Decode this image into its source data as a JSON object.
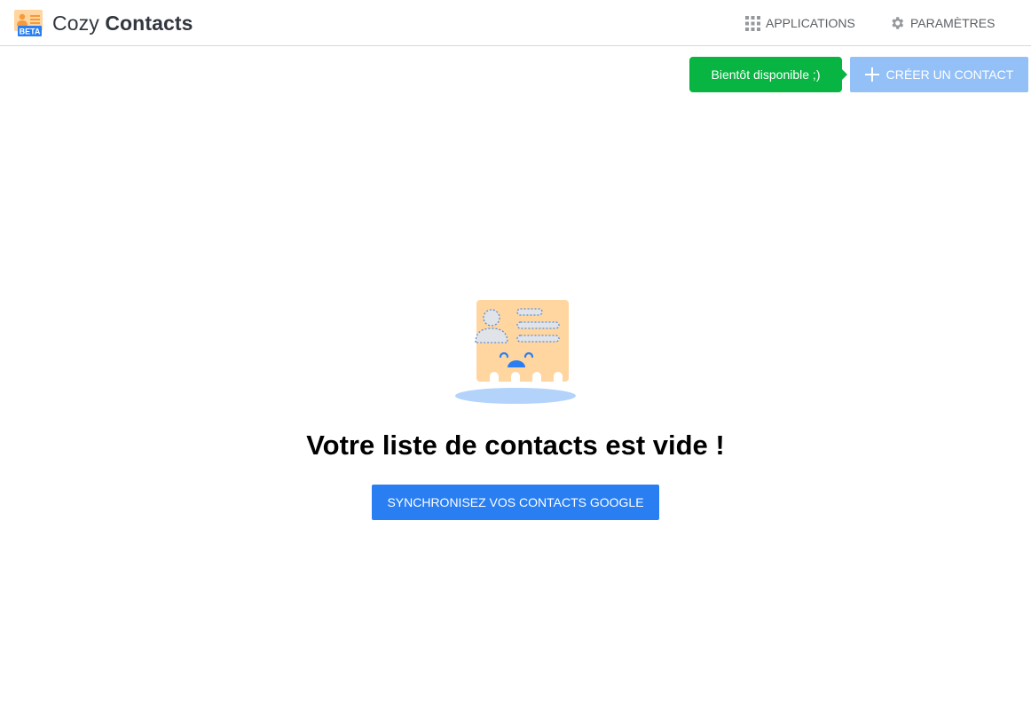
{
  "header": {
    "app_name_light": "Cozy",
    "app_name_bold": "Contacts",
    "logo_badge": "BETA",
    "nav": {
      "applications_label": "APPLICATIONS",
      "settings_label": "PARAMÈTRES"
    }
  },
  "toolbar": {
    "tooltip_text": "Bientôt disponible ;)",
    "create_contact_label": "CRÉER UN CONTACT"
  },
  "empty_state": {
    "title": "Votre liste de contacts est vide !",
    "sync_button_label": "SYNCHRONISEZ VOS CONTACTS GOOGLE"
  },
  "colors": {
    "primary": "#297ef2",
    "primary_disabled": "#94c0f8",
    "tooltip_green": "#08b442",
    "card_orange": "#ffd5a0",
    "shadow_blue": "#b3d3fb"
  },
  "icons": [
    "cozy-contacts-logo",
    "apps-grid-icon",
    "gear-icon",
    "plus-icon",
    "empty-contacts-card-illustration"
  ]
}
